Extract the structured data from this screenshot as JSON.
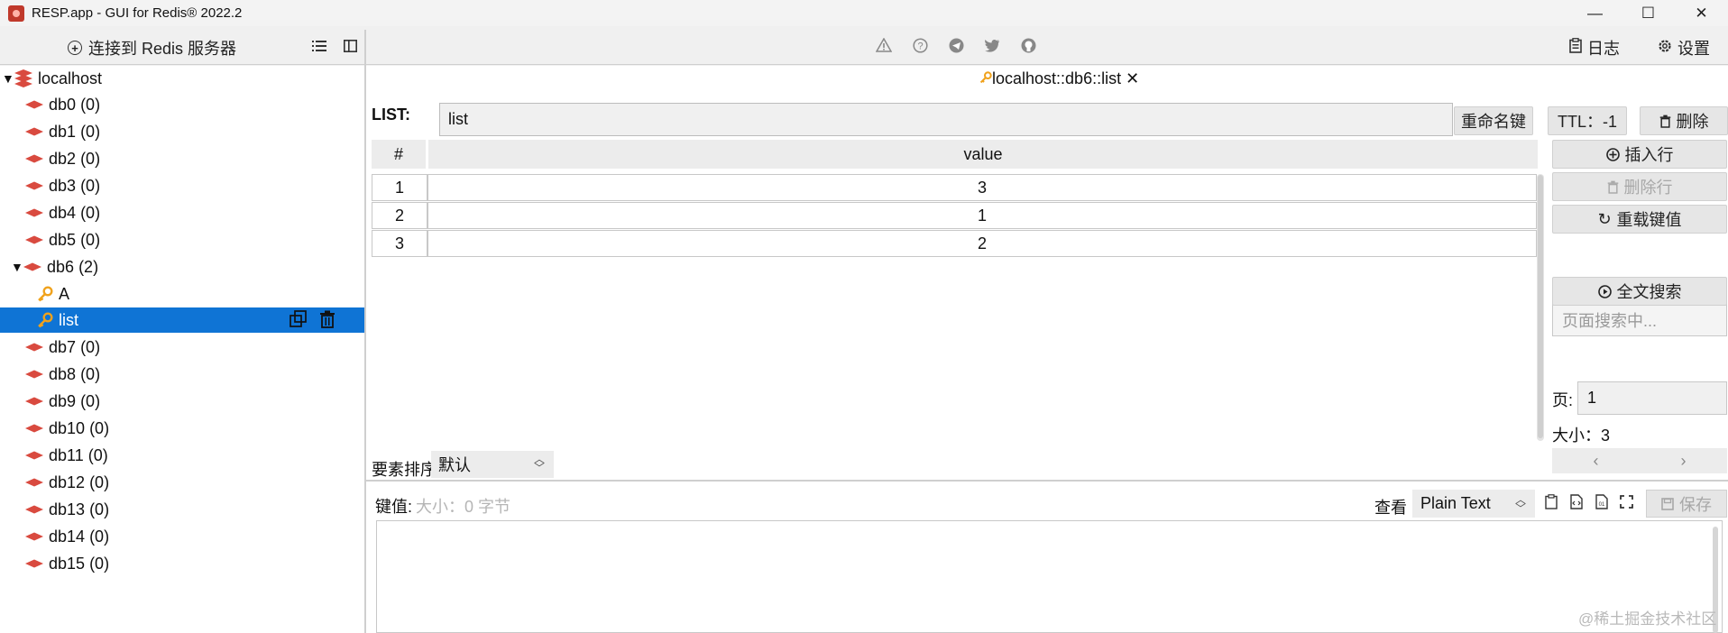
{
  "window": {
    "title": "RESP.app - GUI for Redis® 2022.2",
    "minimize": "—",
    "maximize": "☐",
    "close": "✕"
  },
  "toolbar": {
    "connect_label": "连接到 Redis 服务器",
    "log_label": "日志",
    "settings_label": "设置"
  },
  "tree": {
    "server": "localhost",
    "databases": [
      {
        "name": "db0",
        "count": "(0)"
      },
      {
        "name": "db1",
        "count": "(0)"
      },
      {
        "name": "db2",
        "count": "(0)"
      },
      {
        "name": "db3",
        "count": "(0)"
      },
      {
        "name": "db4",
        "count": "(0)"
      },
      {
        "name": "db5",
        "count": "(0)"
      },
      {
        "name": "db6",
        "count": "(2)"
      },
      {
        "name": "db7",
        "count": "(0)"
      },
      {
        "name": "db8",
        "count": "(0)"
      },
      {
        "name": "db9",
        "count": "(0)"
      },
      {
        "name": "db10",
        "count": "(0)"
      },
      {
        "name": "db11",
        "count": "(0)"
      },
      {
        "name": "db12",
        "count": "(0)"
      },
      {
        "name": "db13",
        "count": "(0)"
      },
      {
        "name": "db14",
        "count": "(0)"
      },
      {
        "name": "db15",
        "count": "(0)"
      }
    ],
    "keys": [
      {
        "name": "A"
      },
      {
        "name": "list"
      }
    ]
  },
  "tab": {
    "title": "localhost::db6::list",
    "close": "✕"
  },
  "key_view": {
    "type_label": "LIST:",
    "key_name": "list",
    "rename_label": "重命名键",
    "ttl_label": "TTL：-1",
    "delete_label": "删除"
  },
  "table": {
    "headers": [
      "#",
      "value"
    ],
    "rows": [
      {
        "index": "1",
        "value": "3"
      },
      {
        "index": "2",
        "value": "1"
      },
      {
        "index": "3",
        "value": "2"
      }
    ]
  },
  "side_actions": {
    "insert_row": "插入行",
    "delete_row": "删除行",
    "reload": "重载键值",
    "search_placeholder": "页面搜索中...",
    "full_search": "全文搜索",
    "page_label": "页:",
    "page_value": "1",
    "size_label": "大小：3",
    "prev": "‹",
    "next": "›"
  },
  "sort": {
    "label": "要素排序",
    "value": "默认"
  },
  "value_editor": {
    "label": "键值:",
    "meta": "大小：0 字节",
    "view_label": "查看",
    "view_mode": "Plain Text",
    "save_label": "保存"
  },
  "watermark": "@稀土掘金技术社区",
  "colors": {
    "selection": "#0f74d5",
    "redis_red": "#d94a3f",
    "key_orange": "#f0a21c"
  }
}
